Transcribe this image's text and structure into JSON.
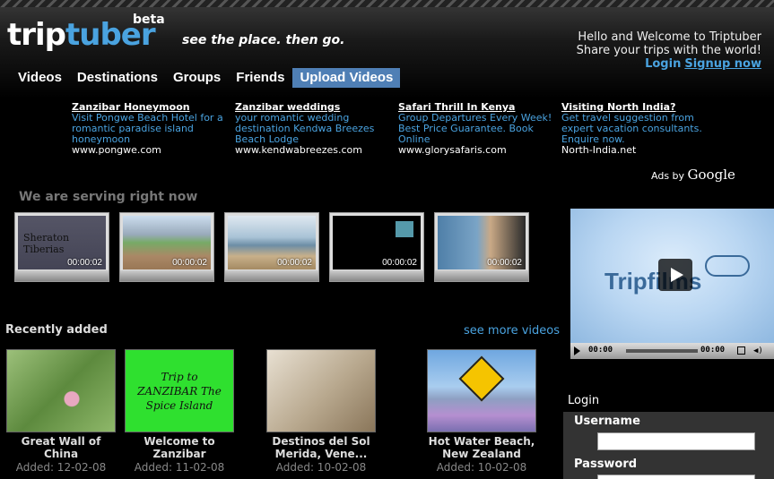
{
  "header": {
    "logo_trip": "trip",
    "logo_tuber": "tuber",
    "beta": "beta",
    "tagline": "see the place. then go.",
    "welcome_line1": "Hello and Welcome to Triptuber",
    "welcome_line2": "Share your trips with the world!",
    "login_link": "Login",
    "signup_link": "Signup now"
  },
  "nav": {
    "items": [
      "Videos",
      "Destinations",
      "Groups",
      "Friends",
      "Upload Videos"
    ],
    "active": "Upload Videos"
  },
  "ads": [
    {
      "title": "Zanzibar Honeymoon",
      "desc": "Visit Pongwe Beach Hotel for a romantic paradise island honeymoon",
      "url": "www.pongwe.com"
    },
    {
      "title": "Zanzibar weddings",
      "desc": "your romantic wedding destination Kendwa Breezes Beach Lodge",
      "url": "www.kendwabreezes.com"
    },
    {
      "title": "Safari Thrill In Kenya",
      "desc": "Group Departures Every Week! Best Price Guarantee. Book Online",
      "url": "www.glorysafaris.com"
    },
    {
      "title": "Visiting North India?",
      "desc": "Get travel suggestion from expert vacation consultants. Enquire now.",
      "url": "North-India.net"
    }
  ],
  "ads_by": "Ads by",
  "ads_by_brand": "Google",
  "serving": {
    "title": "We are serving right now",
    "thumbs": [
      {
        "duration": "00:00:02",
        "caption": "Sheraton Tiberias"
      },
      {
        "duration": "00:00:02"
      },
      {
        "duration": "00:00:02"
      },
      {
        "duration": "00:00:02"
      },
      {
        "duration": "00:00:02"
      }
    ]
  },
  "player": {
    "brand": "Tripfilms",
    "time_current": "00:00",
    "time_total": "00:00"
  },
  "recent": {
    "title": "Recently added",
    "see_more": "see more videos",
    "items": [
      {
        "name": "Great Wall of China",
        "added": "Added: 12-02-08"
      },
      {
        "name": "Welcome to Zanzibar",
        "added": "Added: 11-02-08",
        "image_text": "Trip to ZANZIBAR The Spice Island"
      },
      {
        "name": "Destinos del Sol Merida, Vene...",
        "added": "Added: 10-02-08"
      },
      {
        "name": "Hot Water Beach, New Zealand",
        "added": "Added: 10-02-08"
      }
    ]
  },
  "login": {
    "title": "Login",
    "username_label": "Username",
    "password_label": "Password"
  }
}
